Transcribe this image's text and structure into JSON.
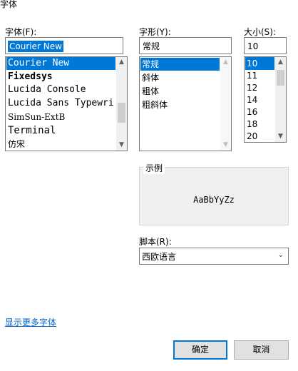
{
  "window": {
    "title": "字体"
  },
  "font": {
    "label": "字体(F):",
    "input_value": "Courier New",
    "items": [
      "Courier New",
      "Fixedsys",
      "Lucida Console",
      "Lucida Sans Typewri",
      "SimSun-ExtB",
      "Terminal",
      "仿宋"
    ],
    "selected_index": 0
  },
  "style": {
    "label": "字形(Y):",
    "input_value": "常规",
    "items": [
      "常规",
      "斜体",
      "粗体",
      "粗斜体"
    ],
    "selected_index": 0
  },
  "size": {
    "label": "大小(S):",
    "input_value": "10",
    "items": [
      "10",
      "11",
      "12",
      "14",
      "16",
      "18",
      "20"
    ],
    "selected_index": 0
  },
  "sample": {
    "label": "示例",
    "text": "AaBbYyZz"
  },
  "script": {
    "label": "脚本(R):",
    "value": "西欧语言"
  },
  "more_fonts_link": "显示更多字体",
  "buttons": {
    "ok": "确定",
    "cancel": "取消"
  },
  "colors": {
    "selection": "#0078d7",
    "link": "#0066cc"
  },
  "icons": {
    "scroll_up": "chevron-up-icon",
    "scroll_down": "chevron-down-icon",
    "dropdown": "chevron-down-icon"
  }
}
